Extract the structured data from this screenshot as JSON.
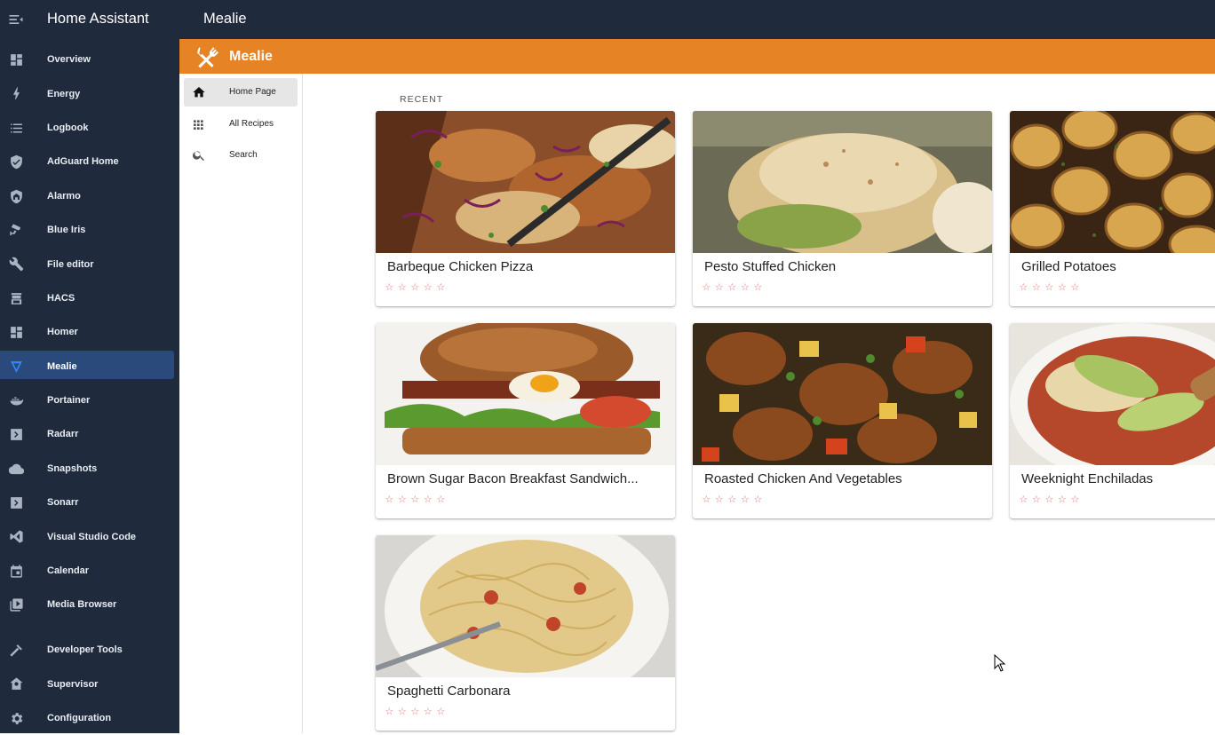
{
  "app": {
    "title": "Home Assistant",
    "panel_title": "Mealie"
  },
  "sidebar": {
    "items": [
      {
        "label": "Overview",
        "icon": "dashboard-icon"
      },
      {
        "label": "Energy",
        "icon": "lightning-icon"
      },
      {
        "label": "Logbook",
        "icon": "list-icon"
      },
      {
        "label": "AdGuard Home",
        "icon": "shield-check-icon"
      },
      {
        "label": "Alarmo",
        "icon": "shield-home-icon"
      },
      {
        "label": "Blue Iris",
        "icon": "cctv-icon"
      },
      {
        "label": "File editor",
        "icon": "wrench-icon"
      },
      {
        "label": "HACS",
        "icon": "hacs-icon"
      },
      {
        "label": "Homer",
        "icon": "dashboard-icon"
      },
      {
        "label": "Mealie",
        "icon": "mealie-icon",
        "active": true
      },
      {
        "label": "Portainer",
        "icon": "docker-icon"
      },
      {
        "label": "Radarr",
        "icon": "chevron-box-icon"
      },
      {
        "label": "Snapshots",
        "icon": "cloud-icon"
      },
      {
        "label": "Sonarr",
        "icon": "chevron-box-icon"
      },
      {
        "label": "Visual Studio Code",
        "icon": "vscode-icon"
      },
      {
        "label": "Calendar",
        "icon": "calendar-icon"
      },
      {
        "label": "Media Browser",
        "icon": "media-icon"
      }
    ],
    "bottom_items": [
      {
        "label": "Developer Tools",
        "icon": "hammer-icon"
      },
      {
        "label": "Supervisor",
        "icon": "supervisor-icon"
      },
      {
        "label": "Configuration",
        "icon": "gear-icon"
      }
    ]
  },
  "mealie": {
    "header_title": "Mealie",
    "accent_color": "#e58325",
    "nav": [
      {
        "label": "Home Page",
        "icon": "home-icon",
        "active": true
      },
      {
        "label": "All Recipes",
        "icon": "grid-icon"
      },
      {
        "label": "Search",
        "icon": "search-icon"
      }
    ],
    "section_label": "RECENT",
    "recipes": [
      {
        "title": "Barbeque Chicken Pizza",
        "rating": 0
      },
      {
        "title": "Pesto Stuffed Chicken",
        "rating": 0
      },
      {
        "title": "Grilled Potatoes",
        "rating": 0
      },
      {
        "title": "Brown Sugar Bacon Breakfast Sandwich...",
        "rating": 0
      },
      {
        "title": "Roasted Chicken And Vegetables",
        "rating": 0
      },
      {
        "title": "Weeknight Enchiladas",
        "rating": 0
      },
      {
        "title": "Spaghetti Carbonara",
        "rating": 0
      }
    ],
    "rating_max": 5
  }
}
